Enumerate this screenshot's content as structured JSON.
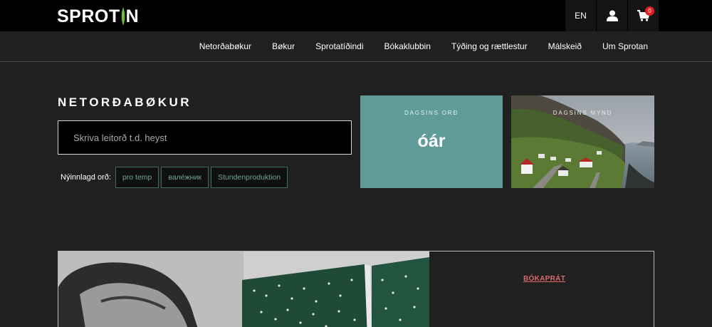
{
  "brand": {
    "logo_text_left": "SPROT",
    "logo_text_right": "N",
    "accent": "#6fbf2a"
  },
  "header": {
    "lang_label": "EN",
    "cart_count": "0",
    "icons": [
      "user-icon",
      "cart-icon"
    ]
  },
  "nav": {
    "items": [
      {
        "label": "Netorðabøkur"
      },
      {
        "label": "Bøkur"
      },
      {
        "label": "Sprotatíðindi"
      },
      {
        "label": "Bókaklubbin"
      },
      {
        "label": "Týðing og rættlestur"
      },
      {
        "label": "Málskeið"
      },
      {
        "label": "Um Sprotan"
      }
    ]
  },
  "main": {
    "title": "NETORÐABØKUR",
    "search_placeholder": "Skriva leitorð t.d. heyst",
    "recent_label": "Nýinnlagd orð:",
    "recent_words": [
      "pro temp",
      "валéжник",
      "Stundenproduktion"
    ]
  },
  "word_card": {
    "label": "DAGSINS ORÐ",
    "word": "óár",
    "color": "#5f9b98"
  },
  "photo_card": {
    "label": "DAGSINS MYND"
  },
  "feature": {
    "link_label": "BÓKAPRÁT"
  }
}
